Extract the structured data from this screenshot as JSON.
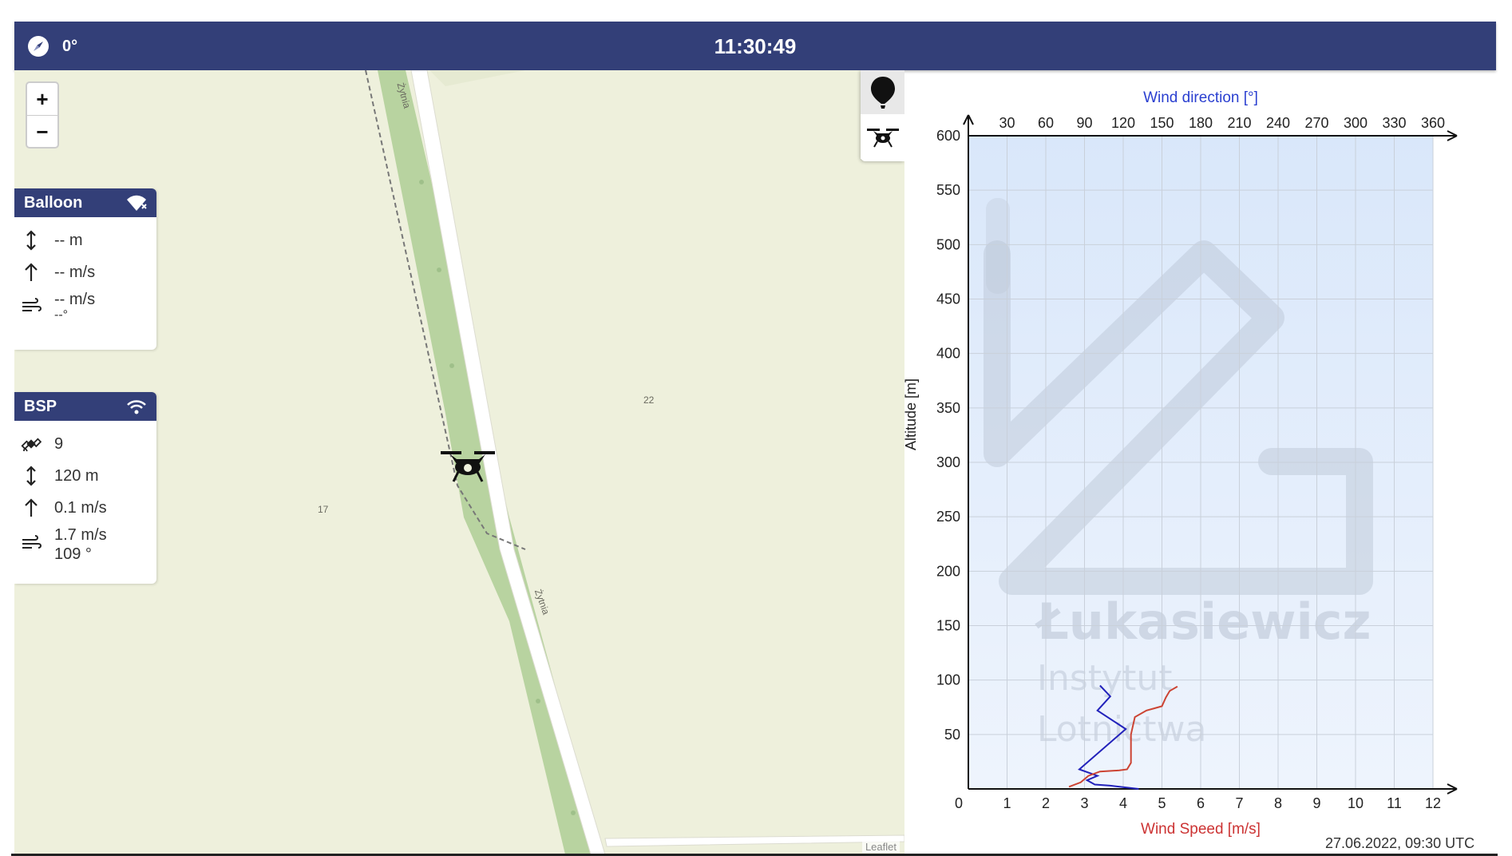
{
  "header": {
    "heading": "0°",
    "clock": "11:30:49"
  },
  "map": {
    "zoom_in": "+",
    "zoom_out": "−",
    "street_top": "Żytnia",
    "street_mid": "Żytnia",
    "plot_label_1": "22",
    "plot_label_2": "17",
    "attribution": "Leaflet",
    "modes": [
      "balloon-icon",
      "drone-icon"
    ]
  },
  "balloon": {
    "title": "Balloon",
    "altitude": "-- m",
    "vspeed": "-- m/s",
    "wind_speed": "-- m/s",
    "wind_dir": "--°"
  },
  "bsp": {
    "title": "BSP",
    "satellites": "9",
    "altitude": "120 m",
    "vspeed": "0.1 m/s",
    "wind_speed": "1.7 m/s",
    "wind_dir": "109 °"
  },
  "chart_data": {
    "type": "line",
    "title": "",
    "top_axis_label": "Wind direction [°]",
    "bottom_axis_label": "Wind Speed [m/s]",
    "ylabel": "Altitude [m]",
    "ylim": [
      0,
      600
    ],
    "yticks": [
      50,
      100,
      150,
      200,
      250,
      300,
      350,
      400,
      450,
      500,
      550,
      600
    ],
    "y_origin_label": "0",
    "speed_lim": [
      0,
      12
    ],
    "speed_ticks": [
      1,
      2,
      3,
      4,
      5,
      6,
      7,
      8,
      9,
      10,
      11,
      12
    ],
    "speed_origin_label": "0",
    "direction_lim": [
      0,
      360
    ],
    "direction_ticks": [
      30,
      60,
      90,
      120,
      150,
      180,
      210,
      240,
      270,
      300,
      330,
      360
    ],
    "grid": true,
    "watermark": [
      "Łukasiewicz",
      "Instytut",
      "Lotnictwa"
    ],
    "series": [
      {
        "axis": "direction",
        "color": "#2222bb",
        "points": [
          [
            132,
            0
          ],
          [
            110,
            3
          ],
          [
            98,
            4
          ],
          [
            92,
            8
          ],
          [
            100,
            12
          ],
          [
            86,
            18
          ],
          [
            122,
            55
          ],
          [
            100,
            72
          ],
          [
            110,
            85
          ],
          [
            102,
            95
          ]
        ]
      },
      {
        "axis": "speed",
        "color": "#cc4433",
        "points": [
          [
            2.6,
            2
          ],
          [
            2.9,
            6
          ],
          [
            3.1,
            12
          ],
          [
            3.4,
            16
          ],
          [
            3.9,
            17
          ],
          [
            4.1,
            18
          ],
          [
            4.2,
            24
          ],
          [
            4.2,
            50
          ],
          [
            4.3,
            66
          ],
          [
            4.6,
            72
          ],
          [
            4.8,
            74
          ],
          [
            5.0,
            76
          ],
          [
            5.1,
            84
          ],
          [
            5.2,
            90
          ],
          [
            5.4,
            94
          ]
        ]
      }
    ]
  },
  "footer": {
    "updated": "27.06.2022, 09:30 UTC"
  }
}
